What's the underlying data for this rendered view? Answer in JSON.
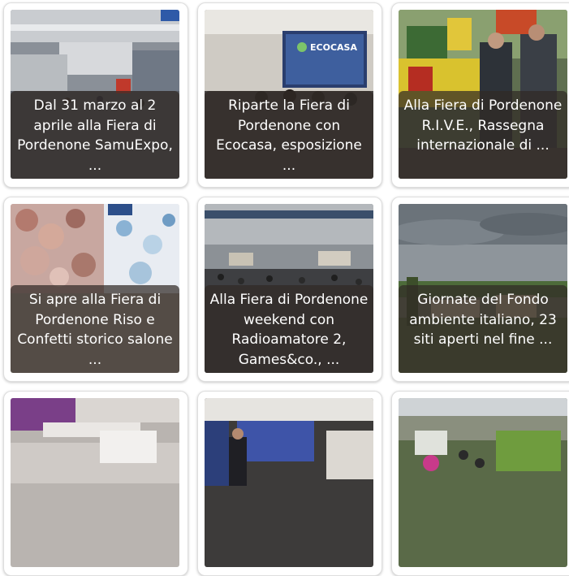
{
  "cards": [
    {
      "caption": "Dal 31 marzo al 2 aprile alla Fiera di Pordenone SamuExpo, ...",
      "image": "exhibition-hall-photo"
    },
    {
      "caption": "Riparte la Fiera di Pordenone con Ecocasa, esposizione ...",
      "image": "conference-stage-photo",
      "screen_text": "ECOCASA"
    },
    {
      "caption": "Alla Fiera di Pordenone R.I.V.E., Rassegna internazionale di ...",
      "image": "agricultural-machinery-photo"
    },
    {
      "caption": "Si apre alla Fiera di Pordenone Riso e Confetti storico salone ...",
      "image": "wedding-fair-stand-photo"
    },
    {
      "caption": "Alla Fiera di Pordenone weekend con Radioamatore 2, Games&co., ...",
      "image": "crowded-hall-photo"
    },
    {
      "caption": "Giornate del Fondo ambiente italiano, 23 siti aperti nel fine ...",
      "image": "landscape-villa-photo"
    },
    {
      "caption": "",
      "image": "exhibition-tent-photo"
    },
    {
      "caption": "",
      "image": "speaker-stage-photo"
    },
    {
      "caption": "",
      "image": "garden-fair-photo"
    }
  ]
}
